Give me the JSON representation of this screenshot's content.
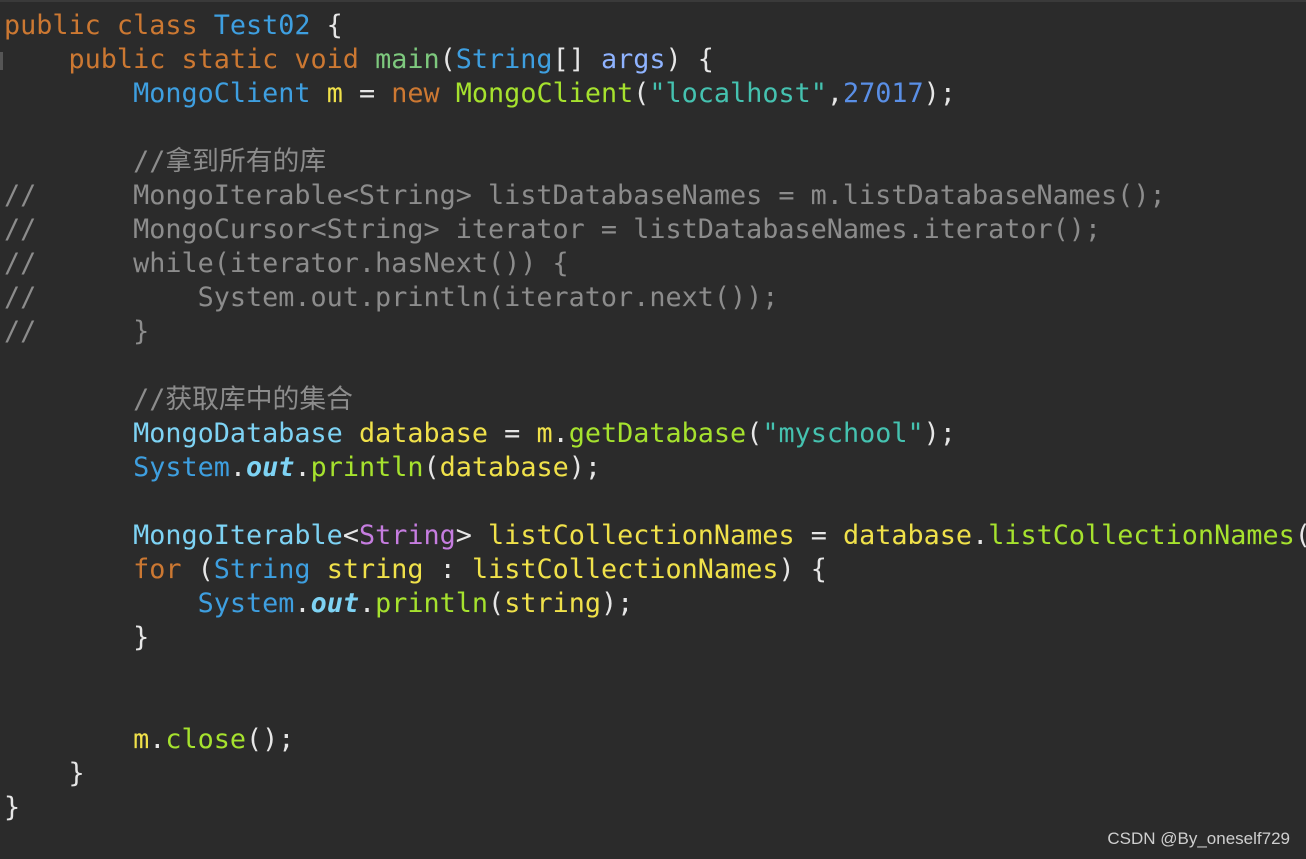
{
  "editor": {
    "theme": {
      "background": "#2b2b2b",
      "default_text": "#e6e6e6",
      "keyword": "#cc7832",
      "type": "#3e9fe0",
      "type_light": "#7ed3f4",
      "variable": "#f0e14a",
      "method": "#a6e22e",
      "string": "#45c2b0",
      "number": "#5a8fe6",
      "comment": "#8c8c8c",
      "generic_type": "#c67de0"
    },
    "lines": [
      [
        {
          "t": "public class ",
          "c": "keyword"
        },
        {
          "t": "Test02",
          "c": "type"
        },
        {
          "t": " {",
          "c": "default"
        }
      ],
      [
        {
          "t": "    public static void ",
          "c": "keyword"
        },
        {
          "t": "main",
          "c": "method-main"
        },
        {
          "t": "(",
          "c": "default"
        },
        {
          "t": "String",
          "c": "type"
        },
        {
          "t": "[] ",
          "c": "default"
        },
        {
          "t": "args",
          "c": "param"
        },
        {
          "t": ") {",
          "c": "default"
        }
      ],
      [
        {
          "t": "        ",
          "c": "default"
        },
        {
          "t": "MongoClient",
          "c": "type"
        },
        {
          "t": " ",
          "c": "default"
        },
        {
          "t": "m",
          "c": "var"
        },
        {
          "t": " = ",
          "c": "default"
        },
        {
          "t": "new ",
          "c": "keyword"
        },
        {
          "t": "MongoClient",
          "c": "method"
        },
        {
          "t": "(",
          "c": "default"
        },
        {
          "t": "\"localhost\"",
          "c": "string"
        },
        {
          "t": ",",
          "c": "default"
        },
        {
          "t": "27017",
          "c": "number"
        },
        {
          "t": ");",
          "c": "default"
        }
      ],
      [],
      [
        {
          "t": "        //拿到所有的库",
          "c": "comment"
        }
      ],
      [
        {
          "t": "//      MongoIterable<String> listDatabaseNames = m.listDatabaseNames();",
          "c": "comment"
        }
      ],
      [
        {
          "t": "//      MongoCursor<String> iterator = listDatabaseNames.iterator();",
          "c": "comment"
        }
      ],
      [
        {
          "t": "//      while(iterator.hasNext()) {",
          "c": "comment"
        }
      ],
      [
        {
          "t": "//          System.out.println(iterator.next());",
          "c": "comment"
        }
      ],
      [
        {
          "t": "//      }",
          "c": "comment"
        }
      ],
      [],
      [
        {
          "t": "        //获取库中的集合",
          "c": "comment"
        }
      ],
      [
        {
          "t": "        ",
          "c": "default"
        },
        {
          "t": "MongoDatabase",
          "c": "type-light"
        },
        {
          "t": " ",
          "c": "default"
        },
        {
          "t": "database",
          "c": "var"
        },
        {
          "t": " = ",
          "c": "default"
        },
        {
          "t": "m",
          "c": "var"
        },
        {
          "t": ".",
          "c": "default"
        },
        {
          "t": "getDatabase",
          "c": "method"
        },
        {
          "t": "(",
          "c": "default"
        },
        {
          "t": "\"myschool\"",
          "c": "string"
        },
        {
          "t": ");",
          "c": "default"
        }
      ],
      [
        {
          "t": "        ",
          "c": "default"
        },
        {
          "t": "System",
          "c": "type"
        },
        {
          "t": ".",
          "c": "default"
        },
        {
          "t": "out",
          "c": "static-field"
        },
        {
          "t": ".",
          "c": "default"
        },
        {
          "t": "println",
          "c": "method"
        },
        {
          "t": "(",
          "c": "default"
        },
        {
          "t": "database",
          "c": "var"
        },
        {
          "t": ");",
          "c": "default"
        }
      ],
      [],
      [
        {
          "t": "        ",
          "c": "default"
        },
        {
          "t": "MongoIterable",
          "c": "type-light"
        },
        {
          "t": "<",
          "c": "default"
        },
        {
          "t": "String",
          "c": "generic"
        },
        {
          "t": "> ",
          "c": "default"
        },
        {
          "t": "listCollectionNames",
          "c": "var"
        },
        {
          "t": " = ",
          "c": "default"
        },
        {
          "t": "database",
          "c": "var"
        },
        {
          "t": ".",
          "c": "default"
        },
        {
          "t": "listCollectionNames",
          "c": "method"
        },
        {
          "t": "()",
          "c": "default"
        }
      ],
      [
        {
          "t": "        ",
          "c": "default"
        },
        {
          "t": "for ",
          "c": "keyword"
        },
        {
          "t": "(",
          "c": "default"
        },
        {
          "t": "String",
          "c": "type"
        },
        {
          "t": " ",
          "c": "default"
        },
        {
          "t": "string",
          "c": "var"
        },
        {
          "t": " : ",
          "c": "default"
        },
        {
          "t": "listCollectionNames",
          "c": "var"
        },
        {
          "t": ") {",
          "c": "default"
        }
      ],
      [
        {
          "t": "            ",
          "c": "default"
        },
        {
          "t": "System",
          "c": "type"
        },
        {
          "t": ".",
          "c": "default"
        },
        {
          "t": "out",
          "c": "static-field"
        },
        {
          "t": ".",
          "c": "default"
        },
        {
          "t": "println",
          "c": "method"
        },
        {
          "t": "(",
          "c": "default"
        },
        {
          "t": "string",
          "c": "var"
        },
        {
          "t": ");",
          "c": "default"
        }
      ],
      [
        {
          "t": "        }",
          "c": "default"
        }
      ],
      [],
      [],
      [
        {
          "t": "        ",
          "c": "default"
        },
        {
          "t": "m",
          "c": "var"
        },
        {
          "t": ".",
          "c": "default"
        },
        {
          "t": "close",
          "c": "method"
        },
        {
          "t": "();",
          "c": "default"
        }
      ],
      [
        {
          "t": "    }",
          "c": "default"
        }
      ],
      [
        {
          "t": "}",
          "c": "default"
        }
      ]
    ]
  },
  "watermark": {
    "text": "CSDN @By_oneself729"
  }
}
